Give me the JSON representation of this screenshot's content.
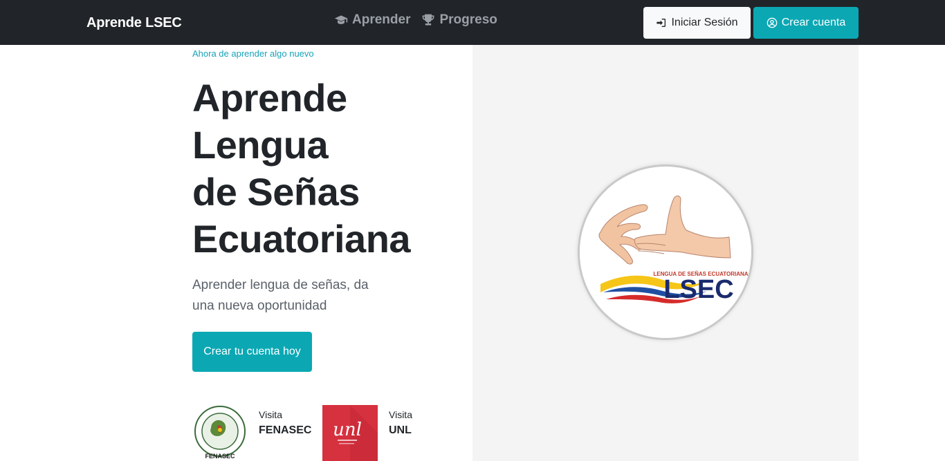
{
  "navbar": {
    "brand": "Aprende LSEC",
    "links": [
      {
        "label": "Aprender",
        "icon": "graduation-cap-icon"
      },
      {
        "label": "Progreso",
        "icon": "trophy-icon"
      }
    ],
    "login_label": "Iniciar Sesión",
    "register_label": "Crear cuenta"
  },
  "hero": {
    "eyebrow": "Ahora de aprender algo nuevo",
    "title_lines": [
      "Aprende",
      "Lengua",
      "de Señas",
      "Ecuatoriana"
    ],
    "subtitle_lines": [
      "Aprender lengua de señas, da",
      "una nueva oportunidad"
    ],
    "cta_label": "Crear tu cuenta hoy"
  },
  "partners": [
    {
      "caption": "Visita",
      "name": "FENASEC",
      "logo_text": "FENASEC"
    },
    {
      "caption": "Visita",
      "name": "UNL",
      "logo_text": "unl"
    }
  ],
  "logo": {
    "tagline": "LENGUA DE SEÑAS ECUATORIANA",
    "wordmark": "LSEC"
  },
  "colors": {
    "navbar_bg": "#212529",
    "accent": "#0ba8b4",
    "unl_red": "#d6313f"
  }
}
